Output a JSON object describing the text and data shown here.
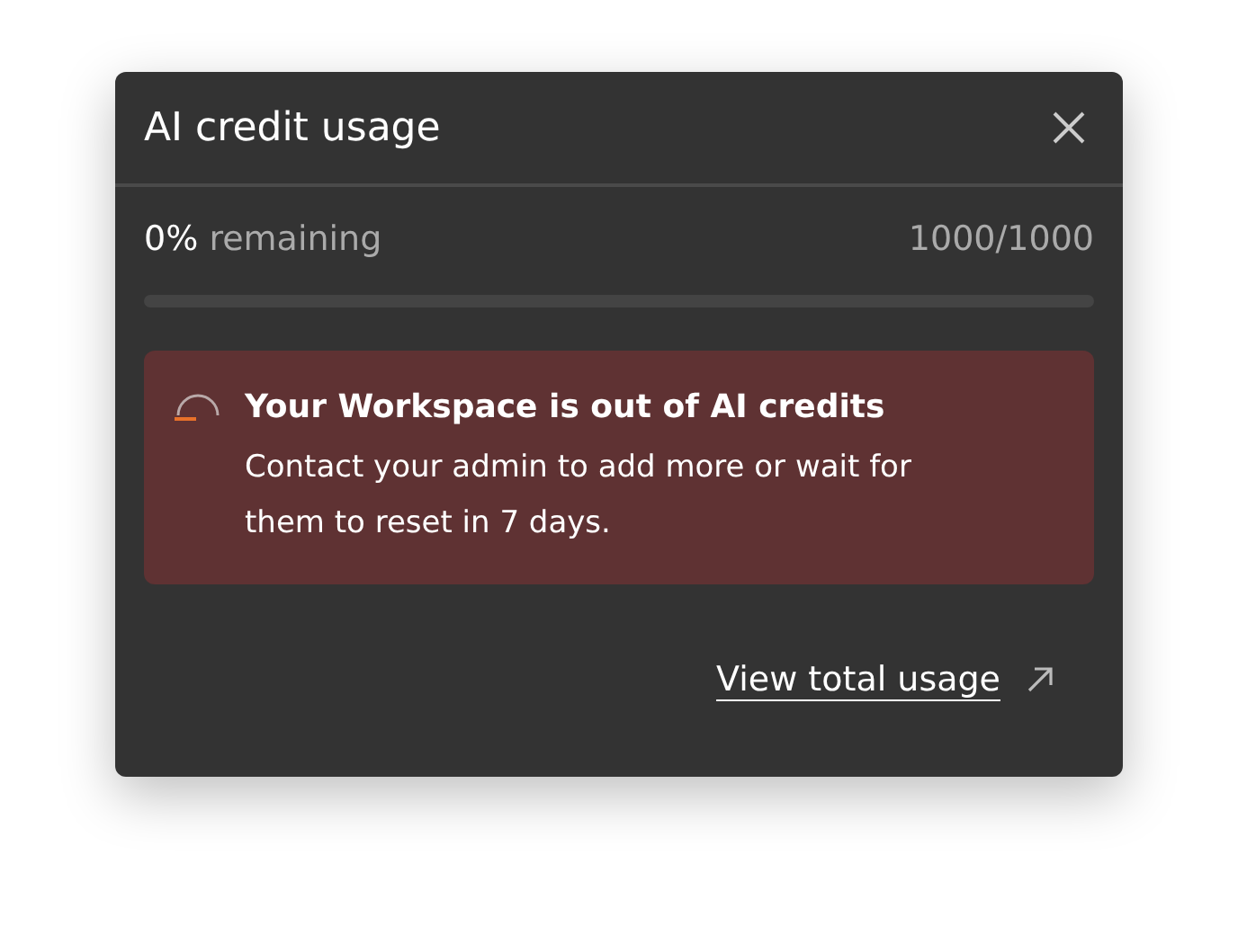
{
  "dialog": {
    "title": "AI credit usage"
  },
  "usage": {
    "percent": "0%",
    "label": "remaining",
    "count": "1000/1000",
    "level": 0
  },
  "alert": {
    "title": "Your Workspace is out of AI credits",
    "message": "Contact your admin to add more or wait for them to reset in 7 days."
  },
  "link": {
    "label": "View total usage"
  }
}
